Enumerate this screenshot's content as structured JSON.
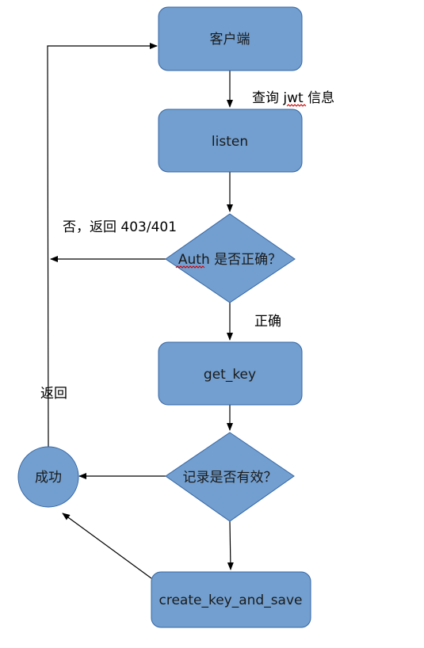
{
  "colors": {
    "node_fill": "#729fcf",
    "node_stroke": "#3465a4",
    "edge": "#000000",
    "spellcheck_underline": "#d00000"
  },
  "nodes": {
    "client": "客户端",
    "listen": "listen",
    "auth_check": "Auth 是否正确？",
    "get_key": "get_key",
    "record_valid": "记录是否有效？",
    "success": "成功",
    "create_key_and_save": "create_key_and_save"
  },
  "edge_labels": {
    "query_jwt": "查询 jwt 信息",
    "auth_fail": "否，返回 403/401",
    "auth_ok": "正确",
    "return": "返回"
  }
}
